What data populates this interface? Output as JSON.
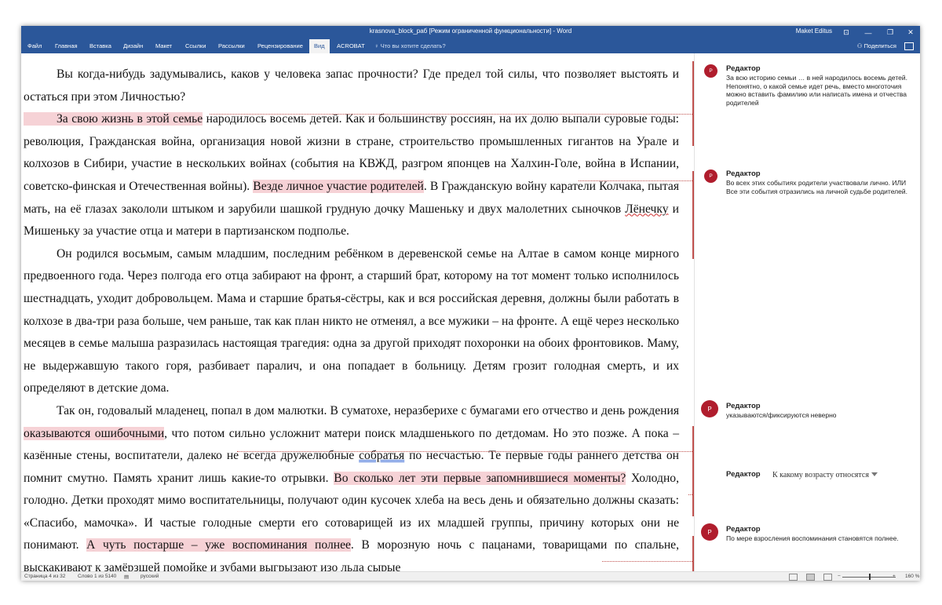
{
  "window": {
    "title": "krasnova_block_раб [Режим ограниченной функциональности]  -  Word",
    "user": "Maket Editus",
    "controls": {
      "ribbon_display": "⊡",
      "minimize": "—",
      "restore": "❐",
      "close": "✕"
    }
  },
  "ribbon": {
    "tabs": [
      "Файл",
      "Главная",
      "Вставка",
      "Дизайн",
      "Макет",
      "Ссылки",
      "Рассылки",
      "Рецензирование",
      "Вид",
      "ACROBAT"
    ],
    "active_tab": "Вид",
    "tell_me": "Что вы хотите сделать?",
    "share": "Поделиться"
  },
  "document": {
    "p1": "Вы когда-нибудь задумывались, каков у человека запас прочности? Где предел той силы, что позволяет выстоять и остаться при этом Личностью?",
    "p2": {
      "h1": "За свою жизнь в этой семье",
      "t1": " народилось восемь детей. Как и большинству россиян, на их долю выпали суровые годы: революция, Гражданская война, организация новой жизни в стране, строительство промышленных гигантов на Урале и колхозов в Сибири, участие в нескольких войнах (события на КВЖД, разгром японцев на Халхин-Голе, война в Испании, советско-финская и Отечественная войны). ",
      "h2": "Везде личное участие родителей",
      "t2": ". В Гражданскую войну каратели Колчака, пытая мать, на её глазах закололи штыком и зарубили шашкой грудную дочку Машеньку и двух малолетних сыночков ",
      "w1": "Лёнечку",
      "t3": " и Мишеньку за участие отца и матери в партизанском подполье."
    },
    "p3": "Он родился восьмым, самым младшим, последним ребёнком в деревенской семье на Алтае в самом конце мирного предвоенного года. Через полгода его отца забирают на фронт, а старший брат, которому на тот момент только исполнилось шестнадцать, уходит добровольцем. Мама и старшие братья-сёстры, как и вся российская деревня, должны были работать в колхозе в два-три раза больше, чем раньше, так как план никто не отменял, а все мужики – на фронте. А ещё через несколько месяцев в семье малыша разразилась настоящая трагедия: одна за другой приходят похоронки на обоих фронтовиков. Маму, не выдержавшую такого горя, разбивает паралич, и она попадает в больницу. Детям грозит голодная смерть, и их определяют в детские дома.",
    "p4": {
      "t1": "Так он, годовалый младенец, попал в дом малютки. В суматохе, неразберихе с бумагами его отчество и день рождения ",
      "h1": "оказываются ошибочными",
      "t2": ", что потом сильно усложнит матери поиск младшенького по детдомам. Но это позже. А пока – казённые стены, воспитатели, далеко не всегда дружелюбные ",
      "w1": "собратья",
      "t3": " по несчастью. Те первые годы раннего детства он помнит смутно. Память хранит лишь какие-то отрывки. ",
      "h2": "Во сколько лет эти первые запомнившиеся моменты?",
      "t4": " Холодно, голодно. Детки проходят мимо воспитательницы, получают один кусочек хлеба на весь день и обязательно должны сказать: «Спасибо, мамочка». И частые голодные смерти его сотоварищей из их младшей группы, причину которых они не понимают. ",
      "h3": "А чуть постарше – уже воспоминания полнее",
      "t5": ". В морозную ночь с пацанами, товарищами по спальне, выскакивают к замёрзшей помойке и зубами выгрызают изо льда сырые"
    }
  },
  "comments": [
    {
      "avatar": "Р",
      "author": "Редактор",
      "lines": [
        "За всю историю семьи … в ней народилось восемь детей.",
        "Непонятно, о какой семье идет речь, вместо многоточия можно вставить фамилию или написать имена и отчества родителей"
      ]
    },
    {
      "avatar": "Р",
      "author": "Редактор",
      "lines": [
        "Во всех этих событиях родители участвовали лично. ИЛИ Все эти события отразились на личной судьбе родителей."
      ]
    },
    {
      "avatar": "Р",
      "author": "Редактор",
      "lines": [
        "указываются/фиксируются неверно"
      ]
    },
    {
      "avatar": "",
      "author": "Редактор",
      "inline": "К какому возрасту относятся"
    },
    {
      "avatar": "Р",
      "author": "Редактор",
      "lines": [
        "По мере взросления воспоминания становятся полнее."
      ]
    }
  ],
  "statusbar": {
    "page": "Страница 4 из 32",
    "words": "Слово 1 из 5140",
    "language": "русский",
    "zoom_minus": "−",
    "zoom_plus": "+",
    "zoom": "160 %"
  },
  "colors": {
    "accent": "#2b579a",
    "comment_avatar": "#b01d2d",
    "highlight": "#f6d2d6",
    "comment_marker": "#c0504d"
  }
}
